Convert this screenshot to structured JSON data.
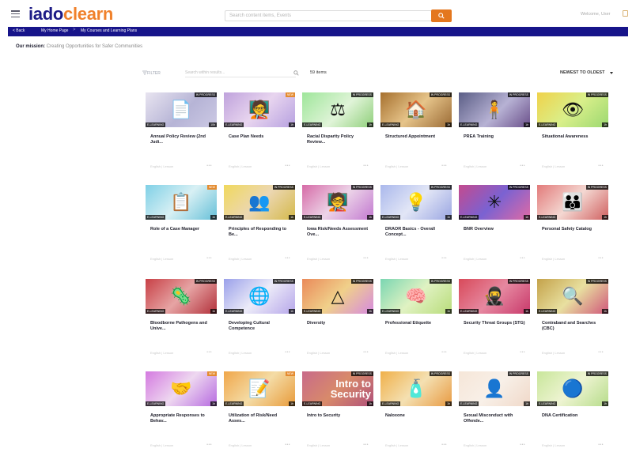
{
  "header": {
    "logo_i": "iado",
    "logo_d": "clearn",
    "search_placeholder": "Search content items, Events",
    "user_name": "Welcome, User",
    "icons": [
      "hamburger-icon",
      "search-icon",
      "chevron-down-icon"
    ],
    "colors": {
      "brand_navy": "#1d1b86",
      "brand_orange": "#f0812b",
      "accent": "#e4771e"
    }
  },
  "nav": {
    "back": "< Back",
    "crumb1": "My Home Page",
    "sep": ">",
    "crumb2": "My Courses and Learning Plans"
  },
  "mission": {
    "label": "Our mission:",
    "text": "Creating Opportunities for Safer Communities"
  },
  "toolbar": {
    "filter": "FILTER",
    "search_placeholder": "Search within results...",
    "items_count": "59 items",
    "sort": "NEWEST TO OLDEST"
  },
  "cards": [
    {
      "title": "Annual Policy Review (2nd Judi...",
      "badge": "IN PROGRESS",
      "type": "E-LEARNING",
      "dur": "10h",
      "meta": "English | Lesson",
      "icon": "document-icon",
      "bg": "linear-gradient(135deg,#e8e4f0,#b6b4d6 55%,#ccc9e4)",
      "glyph": "📄"
    },
    {
      "title": "Case Plan Needs",
      "badge": "NEW",
      "type": "E-LEARNING",
      "dur": "1h",
      "meta": "English | Lesson",
      "icon": "presenter-icon",
      "bg": "linear-gradient(135deg,#bfa2dc,#e8d5ef 50%,#b6a0e0)",
      "glyph": "🧑‍🏫"
    },
    {
      "title": "Racial Disparity Policy Review...",
      "badge": "IN PROGRESS",
      "type": "E-LEARNING",
      "dur": "1h",
      "meta": "English | Lesson",
      "icon": "scales-icon",
      "bg": "linear-gradient(135deg,#9ee69a,#e0f4d8 55%,#8fcf7a)",
      "glyph": "⚖"
    },
    {
      "title": "Structured Appointment",
      "badge": "IN PROGRESS",
      "type": "E-LEARNING",
      "dur": "1h",
      "meta": "English | Lesson",
      "icon": "house-icon",
      "bg": "linear-gradient(135deg,#a6702e,#e6c48a 50%,#9a6a34)",
      "glyph": "🏠"
    },
    {
      "title": "PREA Training",
      "badge": "IN PROGRESS",
      "type": "E-LEARNING",
      "dur": "1h",
      "meta": "English | Lesson",
      "icon": "person-icon",
      "bg": "linear-gradient(135deg,#5b5e86,#b7b2d4 55%,#6a4f8a)",
      "glyph": "🧍"
    },
    {
      "title": "Situational Awareness",
      "badge": "IN PROGRESS",
      "type": "E-LEARNING",
      "dur": "1h",
      "meta": "English | Lesson",
      "icon": "eye-icon",
      "bg": "linear-gradient(135deg,#f0d24a,#d9ef8a 50%,#9bd870)",
      "glyph": "👁"
    },
    {
      "title": "Role of a Case Manager",
      "badge": "NEW",
      "type": "E-LEARNING",
      "dur": "1h",
      "meta": "English | Lesson",
      "icon": "clipboard-hand-icon",
      "bg": "linear-gradient(135deg,#7fd0e6,#d8f0f4 50%,#66c0d8)",
      "glyph": "📋"
    },
    {
      "title": "Principles of Responding to Be...",
      "badge": "IN PROGRESS",
      "type": "E-LEARNING",
      "dur": "1h",
      "meta": "English | Lesson",
      "icon": "group-icon",
      "bg": "linear-gradient(135deg,#f0d85c,#ecd7b2 50%,#d4b94a)",
      "glyph": "👥"
    },
    {
      "title": "Iowa Risk/Needs Assessment Ove...",
      "badge": "IN PROGRESS",
      "type": "E-LEARNING",
      "dur": "1h",
      "meta": "English | Lesson",
      "icon": "presenter-icon",
      "bg": "linear-gradient(135deg,#d66aa6,#ecd4e8 50%,#c278d0)",
      "glyph": "🧑‍🏫"
    },
    {
      "title": "DRAOR Basics - Overall Concept...",
      "badge": "IN PROGRESS",
      "type": "E-LEARNING",
      "dur": "1h",
      "meta": "English | Lesson",
      "icon": "lightbulb-icon",
      "bg": "linear-gradient(135deg,#aab8ec,#e2e6f6 50%,#9aa6e2)",
      "glyph": "💡"
    },
    {
      "title": "BNR Overview",
      "badge": "IN PROGRESS",
      "type": "E-LEARNING",
      "dur": "1h",
      "meta": "English | Lesson",
      "icon": "network-icon",
      "bg": "linear-gradient(135deg,#c44a8e,#7a62d2 50%,#e06aa4)",
      "glyph": "✳"
    },
    {
      "title": "Personal Safety Catalog",
      "badge": "IN PROGRESS",
      "type": "E-LEARNING",
      "dur": "1h",
      "meta": "English | Lesson",
      "icon": "people-icon",
      "bg": "linear-gradient(135deg,#e27a7a,#f4d8d2 50%,#d06060)",
      "glyph": "👪"
    },
    {
      "title": "Bloodborne Pathogens and Unive...",
      "badge": "IN PROGRESS",
      "type": "E-LEARNING",
      "dur": "1h",
      "meta": "English | Lesson",
      "icon": "bacteria-icon",
      "bg": "linear-gradient(135deg,#c84046,#e6a4a4 50%,#b2303a)",
      "glyph": "🦠"
    },
    {
      "title": "Developing Cultural Competence",
      "badge": "IN PROGRESS",
      "type": "E-LEARNING",
      "dur": "1h",
      "meta": "English | Lesson",
      "icon": "globe-person-icon",
      "bg": "linear-gradient(135deg,#9aa0ea,#ecebf8 50%,#b6a6ea)",
      "glyph": "🌐"
    },
    {
      "title": "Diversity",
      "badge": "IN PROGRESS",
      "type": "E-LEARNING",
      "dur": "1h",
      "meta": "English | Lesson",
      "icon": "shapes-icon",
      "bg": "linear-gradient(135deg,#ea8a5a,#f0d08a 50%,#d68ae0)",
      "glyph": "△"
    },
    {
      "title": "Professional Etiquette",
      "badge": "IN PROGRESS",
      "type": "E-LEARNING",
      "dur": "1h",
      "meta": "English | Lesson",
      "icon": "head-icon",
      "bg": "linear-gradient(135deg,#7ad6b2,#e0f2c2 50%,#b8dc7a)",
      "glyph": "🧠"
    },
    {
      "title": "Security Threat Groups (STG)",
      "badge": "IN PROGRESS",
      "type": "E-LEARNING",
      "dur": "1h",
      "meta": "English | Lesson",
      "icon": "masks-icon",
      "bg": "linear-gradient(135deg,#d84a5a,#e688a0 50%,#c8386a)",
      "glyph": "🥷"
    },
    {
      "title": "Contraband and Searches (CBC)",
      "badge": "IN PROGRESS",
      "type": "E-LEARNING",
      "dur": "1h",
      "meta": "English | Lesson",
      "icon": "magnifier-icon",
      "bg": "linear-gradient(135deg,#c4a24a,#e8e0a0 50%,#d0567a)",
      "glyph": "🔍"
    },
    {
      "title": "Appropriate Responses to Behav...",
      "badge": "NEW",
      "type": "E-LEARNING",
      "dur": "1h",
      "meta": "English | Lesson",
      "icon": "people-network-icon",
      "bg": "linear-gradient(135deg,#d47ae0,#eed8f0 50%,#b66ae0)",
      "glyph": "🤝"
    },
    {
      "title": "Utilization of Risk/Need Asses...",
      "badge": "NEW",
      "type": "E-LEARNING",
      "dur": "1h",
      "meta": "English | Lesson",
      "icon": "clipboard-icon",
      "bg": "linear-gradient(135deg,#f0a64a,#f4dca6 50%,#e89a3a)",
      "glyph": "📝"
    },
    {
      "title": "Intro to Security",
      "badge": "IN PROGRESS",
      "type": "E-LEARNING",
      "dur": "1h",
      "meta": "English | Lesson",
      "icon": "text-thumb",
      "bg": "linear-gradient(135deg,#c86a8a,#d88a6a 50%,#b0507a)",
      "glyph": "Intro to Security"
    },
    {
      "title": "Naloxone",
      "badge": "IN PROGRESS",
      "type": "E-LEARNING",
      "dur": "1h",
      "meta": "English | Lesson",
      "icon": "bottle-icon",
      "bg": "linear-gradient(135deg,#f0b04a,#f4e0b2 50%,#e89a42)",
      "glyph": "🧴"
    },
    {
      "title": "Sexual Misconduct with Offende...",
      "badge": "IN PROGRESS",
      "type": "E-LEARNING",
      "dur": "1h",
      "meta": "English | Lesson",
      "icon": "faded-icon",
      "bg": "linear-gradient(135deg,#f6e6d8,#f8f0e8 50%,#f0d8c8)",
      "glyph": "👤"
    },
    {
      "title": "DNA Certification",
      "badge": "IN PROGRESS",
      "type": "E-LEARNING",
      "dur": "1h",
      "meta": "English | Lesson",
      "icon": "seal-icon",
      "bg": "linear-gradient(135deg,#c8e69a,#eef4d2 50%,#b6dc8a)",
      "glyph": "🔵"
    }
  ]
}
